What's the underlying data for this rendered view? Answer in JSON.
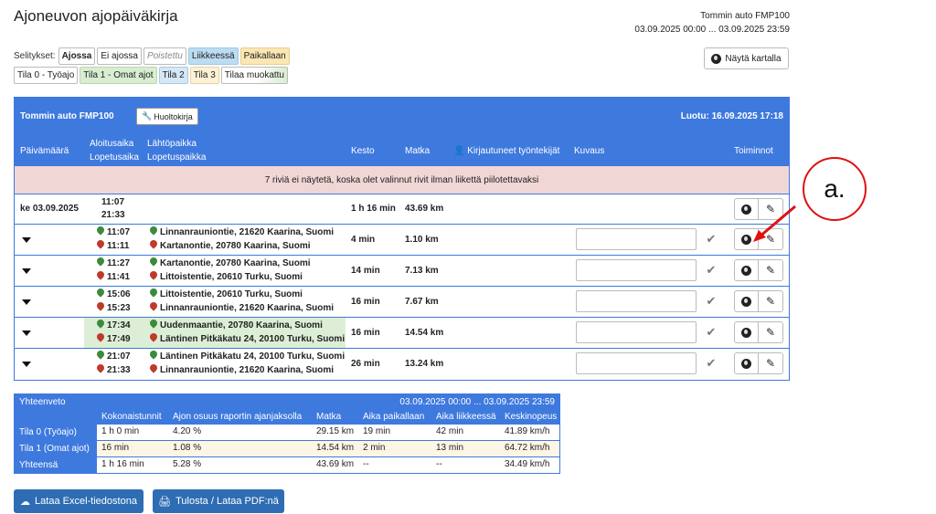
{
  "header": {
    "title": "Ajoneuvon ajopäiväkirja",
    "vehicle": "Tommin auto FMP100",
    "period": "03.09.2025 00:00 ... 03.09.2025 23:59"
  },
  "legend": {
    "label": "Selitykset:",
    "items": [
      "Ajossa",
      "Ei ajossa",
      "Poistettu",
      "Liikkeessä",
      "Paikallaan"
    ],
    "states": [
      "Tila 0 - Työajo",
      "Tila 1 - Omat ajot",
      "Tila 2",
      "Tila 3",
      "Tilaa muokattu"
    ]
  },
  "map_button": "Näytä kartalla",
  "table": {
    "vehicle": "Tommin auto FMP100",
    "logbook_button": "Huoltokirja",
    "created": "Luotu: 16.09.2025 17:18",
    "columns": {
      "date": "Päivämäärä",
      "start_time": "Aloitusaika",
      "end_time": "Lopetusaika",
      "start_place": "Lähtöpaikka",
      "end_place": "Lopetuspaikka",
      "duration": "Kesto",
      "distance": "Matka",
      "employees": "Kirjautuneet työntekijät",
      "description": "Kuvaus",
      "actions": "Toiminnot"
    },
    "notice": "7 riviä ei näytetä, koska olet valinnut rivit ilman liikettä piilotettavaksi",
    "day": {
      "date": "ke 03.09.2025",
      "start": "11:07",
      "end": "21:33",
      "duration": "1 h 16 min",
      "distance": "43.69 km"
    },
    "trips": [
      {
        "start": "11:07",
        "end": "11:11",
        "from": "Linnanrauniontie, 21620 Kaarina, Suomi",
        "to": "Kartanontie, 20780 Kaarina, Suomi",
        "duration": "4 min",
        "distance": "1.10 km"
      },
      {
        "start": "11:27",
        "end": "11:41",
        "from": "Kartanontie, 20780 Kaarina, Suomi",
        "to": "Littoistentie, 20610 Turku, Suomi",
        "duration": "14 min",
        "distance": "7.13 km"
      },
      {
        "start": "15:06",
        "end": "15:23",
        "from": "Littoistentie, 20610 Turku, Suomi",
        "to": "Linnanrauniontie, 21620 Kaarina, Suomi",
        "duration": "16 min",
        "distance": "7.67 km"
      },
      {
        "start": "17:34",
        "end": "17:49",
        "from": "Uudenmaantie, 20780 Kaarina, Suomi",
        "to": "Läntinen Pitkäkatu 24, 20100 Turku, Suomi",
        "duration": "16 min",
        "distance": "14.54 km"
      },
      {
        "start": "21:07",
        "end": "21:33",
        "from": "Läntinen Pitkäkatu 24, 20100 Turku, Suomi",
        "to": "Linnanrauniontie, 21620 Kaarina, Suomi",
        "duration": "26 min",
        "distance": "13.24 km"
      }
    ]
  },
  "annotation": "a.",
  "summary": {
    "title": "Yhteenveto",
    "period": "03.09.2025 00:00 ... 03.09.2025 23:59",
    "columns": [
      "Kokonaistunnit",
      "Ajon osuus raportin ajanjaksolla",
      "Matka",
      "Aika paikallaan",
      "Aika liikkeessä",
      "Keskinopeus"
    ],
    "rows": [
      {
        "label": "Tila 0 (Työajo)",
        "values": [
          "1 h 0 min",
          "4.20 %",
          "29.15 km",
          "19 min",
          "42 min",
          "41.89 km/h"
        ]
      },
      {
        "label": "Tila 1 (Omat ajot)",
        "values": [
          "16 min",
          "1.08 %",
          "14.54 km",
          "2 min",
          "13 min",
          "64.72 km/h"
        ]
      },
      {
        "label": "Yhteensä",
        "values": [
          "1 h 16 min",
          "5.28 %",
          "43.69 km",
          "--",
          "--",
          "34.49 km/h"
        ]
      }
    ]
  },
  "buttons": {
    "excel": "Lataa Excel-tiedostona",
    "pdf": "Tulosta / Lataa PDF:nä"
  }
}
